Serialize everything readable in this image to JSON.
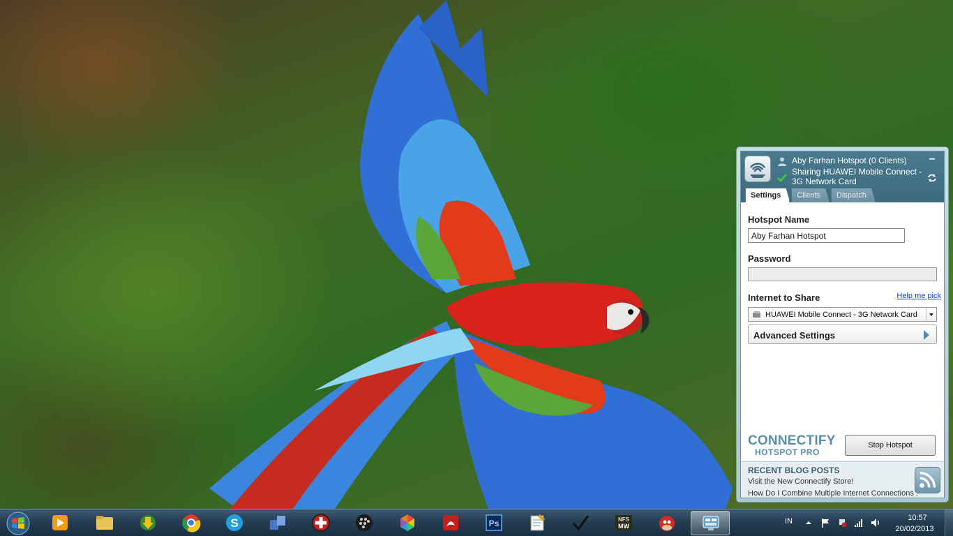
{
  "desktop": {
    "wallpaper": "scarlet-macaw-flying"
  },
  "connectify": {
    "header": {
      "title": "Aby Farhan Hotspot (0 Clients)",
      "status": "Sharing HUAWEI Mobile Connect - 3G Network Card"
    },
    "tabs": [
      {
        "label": "Settings",
        "active": true
      },
      {
        "label": "Clients",
        "active": false
      },
      {
        "label": "Dispatch",
        "active": false
      }
    ],
    "settings": {
      "hotspot_name_label": "Hotspot Name",
      "hotspot_name_value": "Aby Farhan Hotspot",
      "password_label": "Password",
      "password_value": "",
      "internet_label": "Internet to Share",
      "help_link": "Help me pick",
      "internet_selected": "HUAWEI Mobile Connect - 3G Network Card",
      "advanced_label": "Advanced Settings"
    },
    "brand": {
      "line1": "CONNECTIFY",
      "line2": "HOTSPOT PRO"
    },
    "stop_button": "Stop Hotspot",
    "blog": {
      "title": "RECENT BLOG POSTS",
      "items": [
        "Visit the New Connectify Store!",
        "How Do I Combine Multiple Internet Connections ."
      ]
    },
    "colors": {
      "header": "#3d6a7e",
      "brand": "#5a8fa8",
      "link": "#1a3ad6"
    }
  },
  "taskbar": {
    "pinned": [
      {
        "name": "windows-media-player"
      },
      {
        "name": "windows-explorer"
      },
      {
        "name": "internet-download-manager"
      },
      {
        "name": "google-chrome"
      },
      {
        "name": "skype"
      },
      {
        "name": "windows-live"
      },
      {
        "name": "avira-rescue"
      },
      {
        "name": "blackberry-desktop"
      },
      {
        "name": "picasa"
      },
      {
        "name": "acrobat-reader"
      },
      {
        "name": "photoshop"
      },
      {
        "name": "notepad"
      },
      {
        "name": "checkmark-app"
      },
      {
        "name": "nfs-most-wanted"
      },
      {
        "name": "angry-birds"
      },
      {
        "name": "connectify",
        "active": true
      }
    ],
    "tray": {
      "language": "IN",
      "time": "10:57",
      "date": "20/02/2013"
    }
  }
}
